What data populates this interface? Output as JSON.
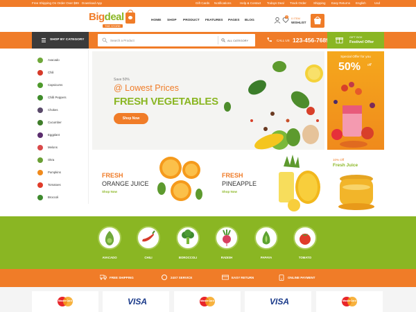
{
  "topbar": {
    "free_shipping": "Free Shipping On Order Over $99",
    "download_app": "Download App",
    "links": [
      "Gift Cards",
      "Notifications",
      "Help & Contact",
      "Todays Deal",
      "Track Order",
      "Shipping",
      "Easy Returns",
      "English",
      "Usd"
    ]
  },
  "header": {
    "logo_part1": "Big",
    "logo_part2": "deal",
    "logo_sub": "THE STORE",
    "nav": [
      "HOME",
      "SHOP",
      "PRODUCT",
      "FEATURES",
      "PAGES",
      "BLOG"
    ],
    "wishlist_count": "0",
    "wishlist_price": "0 ITEM",
    "wishlist_label": "WISHLIST"
  },
  "search": {
    "category_button": "SHOP BY CATEGORY",
    "placeholder": "Search a Product",
    "all_category": "ALL CATEGORY",
    "call_label": "CALL US",
    "phone": "123-456-76890",
    "gift_line1": "GIFT BOX",
    "gift_line2": "Festivel Offer"
  },
  "sidebar": {
    "items": [
      {
        "label": "Avacado",
        "color": "#6fa83a"
      },
      {
        "label": "Chili",
        "color": "#d63a2a"
      },
      {
        "label": "Capsicums",
        "color": "#4e9a2c"
      },
      {
        "label": "Chilli Peppers",
        "color": "#3f8c2b"
      },
      {
        "label": "Chokes",
        "color": "#5a4a6a"
      },
      {
        "label": "Cucumber",
        "color": "#3f7d2a"
      },
      {
        "label": "Eggplant",
        "color": "#5b2d6e"
      },
      {
        "label": "Melons",
        "color": "#d94a4a"
      },
      {
        "label": "Okra",
        "color": "#6a9f35"
      },
      {
        "label": "Pumpkins",
        "color": "#f08a1c"
      },
      {
        "label": "Tomatoes",
        "color": "#e03c2a"
      },
      {
        "label": "Broccoli",
        "color": "#3e8a2e"
      }
    ]
  },
  "hero": {
    "save": "Save 50%",
    "headline": "@ Lowest Prices",
    "title": "FRESH VEGETABLES",
    "button": "Shop Now"
  },
  "special": {
    "line1": "Special Offer for you",
    "percent": "50%",
    "off": "off"
  },
  "promos": [
    {
      "line1": "FRESH",
      "line2": "ORANGE JUICE",
      "link": "Shop Now"
    },
    {
      "line1": "FRESH",
      "line2": "PINEAPPLE",
      "link": "Shop Now"
    },
    {
      "line1": "10% Off",
      "line2": "Fresh Juice"
    }
  ],
  "categories": [
    "AVACADO",
    "CHILI",
    "BOROCCOLI",
    "RADISH",
    "PAPAYA",
    "TOMATO"
  ],
  "features": [
    "FREE SHIPPING",
    "24X7 SERVICE",
    "EASY RETURN",
    "ONLINE PAYMENT"
  ],
  "payments": [
    "MasterCard",
    "VISA",
    "MasterCard",
    "VISA",
    "MasterCard"
  ],
  "colors": {
    "accent": "#f07c28",
    "green": "#8ab623",
    "dark": "#3b3b3b"
  }
}
